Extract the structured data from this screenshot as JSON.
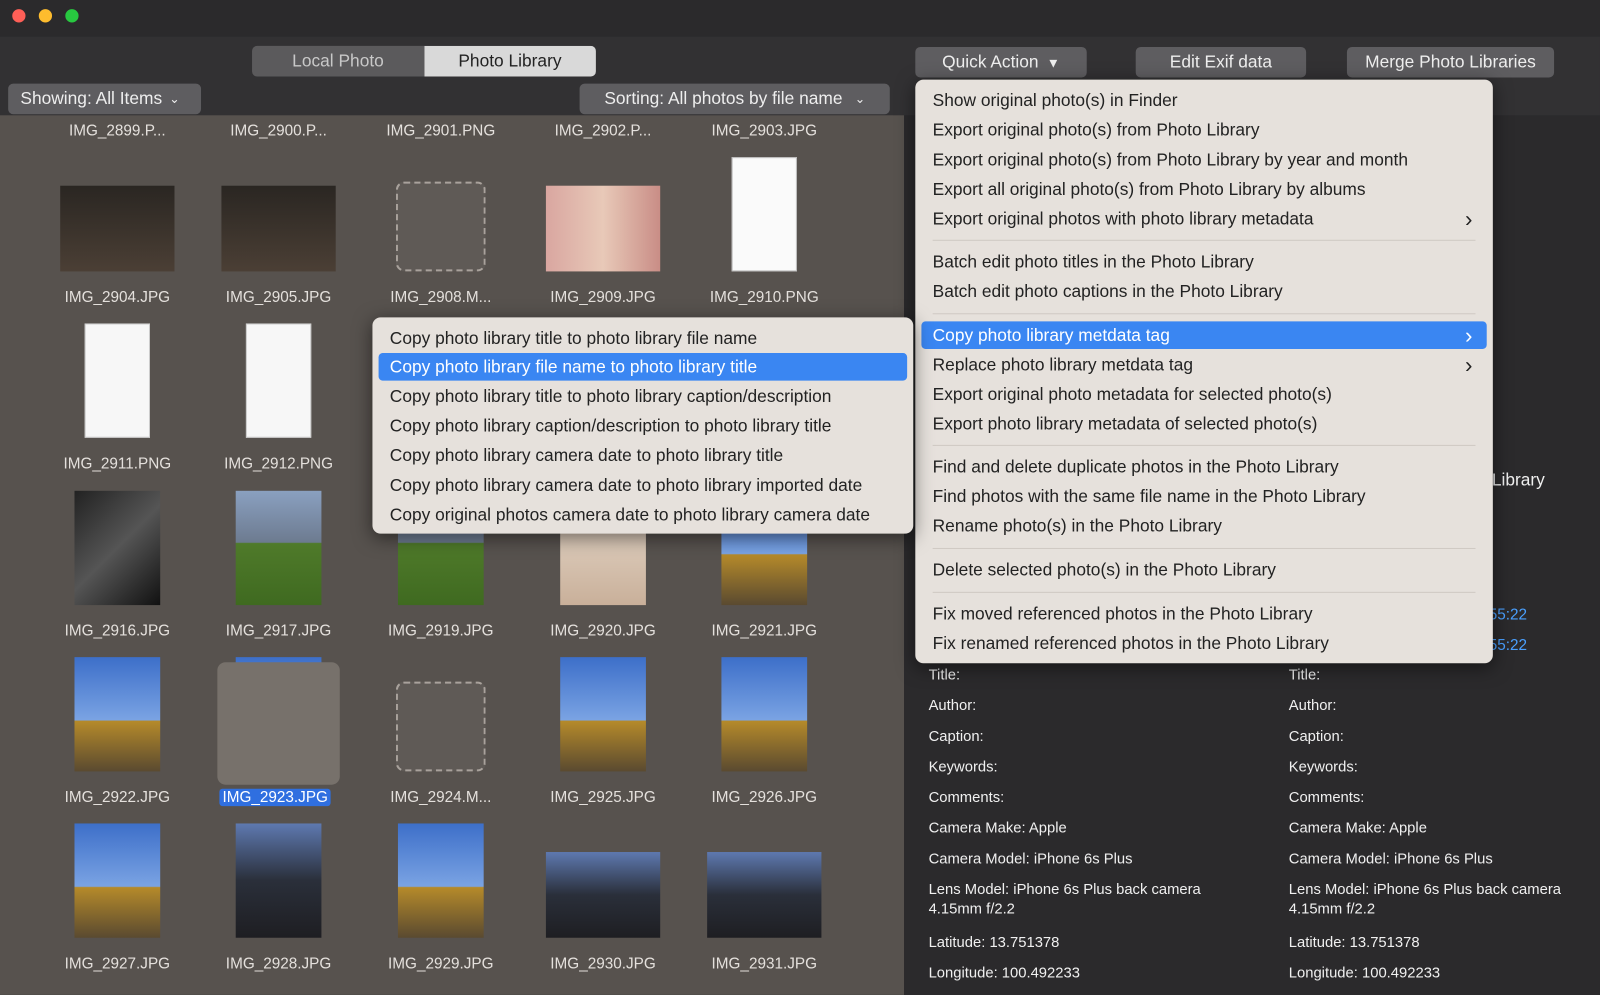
{
  "window": {
    "controls": [
      "close",
      "minimize",
      "zoom"
    ],
    "colors": {
      "close": "#fe5f57",
      "minimize": "#febc2e",
      "zoom": "#28c840",
      "accent": "#3a86f2"
    }
  },
  "tabs": [
    {
      "label": "Local Photo",
      "active": false
    },
    {
      "label": "Photo Library",
      "active": true
    }
  ],
  "toolbar": {
    "quick_action": "Quick Action",
    "edit_exif": "Edit Exif data",
    "merge": "Merge Photo Libraries"
  },
  "filters": {
    "showing": "Showing: All Items",
    "sorting": "Sorting: All photos by file name"
  },
  "photos": [
    [
      "IMG_2899.P...",
      "IMG_2900.P...",
      "IMG_2901.PNG",
      "IMG_2902.P...",
      "IMG_2903.JPG"
    ],
    [
      "IMG_2904.JPG",
      "IMG_2905.JPG",
      "IMG_2908.M...",
      "IMG_2909.JPG",
      "IMG_2910.PNG"
    ],
    [
      "IMG_2911.PNG",
      "IMG_2912.PNG",
      "",
      "",
      ""
    ],
    [
      "IMG_2916.JPG",
      "IMG_2917.JPG",
      "IMG_2919.JPG",
      "IMG_2920.JPG",
      "IMG_2921.JPG"
    ],
    [
      "IMG_2922.JPG",
      "IMG_2923.JPG",
      "IMG_2924.M...",
      "IMG_2925.JPG",
      "IMG_2926.JPG"
    ],
    [
      "IMG_2927.JPG",
      "IMG_2928.JPG",
      "IMG_2929.JPG",
      "IMG_2930.JPG",
      "IMG_2931.JPG"
    ]
  ],
  "selected_photo": "IMG_2923.JPG",
  "quick_menu": [
    {
      "label": "Show original photo(s) in Finder"
    },
    {
      "label": "Export original photo(s) from Photo Library"
    },
    {
      "label": "Export original photo(s) from Photo Library by year and month"
    },
    {
      "label": "Export all original photo(s) from Photo Library by albums"
    },
    {
      "label": "Export original photos with photo library metadata",
      "submenu": true
    },
    {
      "label": "Batch edit photo titles in the Photo Library"
    },
    {
      "label": "Batch edit photo captions in the Photo Library"
    },
    {
      "label": "Copy photo library metdata tag",
      "submenu": true,
      "highlighted": true
    },
    {
      "label": "Replace photo library metdata tag",
      "submenu": true
    },
    {
      "label": "Export original photo metadata for selected photo(s)"
    },
    {
      "label": "Export photo library metadata of selected photo(s)"
    },
    {
      "label": "Find and delete duplicate photos in the Photo Library"
    },
    {
      "label": "Find photos with the same file name in the Photo Library"
    },
    {
      "label": "Rename photo(s) in the Photo Library"
    },
    {
      "label": "Delete selected photo(s) in the Photo Library"
    },
    {
      "label": "Fix moved referenced photos in the Photo Library"
    },
    {
      "label": "Fix renamed referenced photos in the Photo Library"
    }
  ],
  "sub_menu": [
    {
      "label": "Copy photo library title to photo library file name"
    },
    {
      "label": "Copy photo library file name to photo library title",
      "highlighted": true
    },
    {
      "label": "Copy photo library title to photo library caption/description"
    },
    {
      "label": "Copy photo library caption/description to photo library title"
    },
    {
      "label": "Copy photo library camera date to photo library title"
    },
    {
      "label": "Copy photo library camera date to photo library imported date"
    },
    {
      "label": "Copy original photos camera date to photo library camera date"
    }
  ],
  "right": {
    "partial_label": "Library",
    "date_fragment_1": "55:22",
    "date_fragment_2": "55:22",
    "left_meta": [
      "Title:",
      "Author:",
      "Caption:",
      "Keywords:",
      "Comments:",
      "Camera Make: Apple",
      "Camera Model: iPhone 6s Plus",
      "Lens Model: iPhone 6s Plus back camera 4.15mm f/2.2",
      "Latitude: 13.751378",
      "Longitude: 100.492233"
    ],
    "right_meta": [
      "Title:",
      "Author:",
      "Caption:",
      "Keywords:",
      "Comments:",
      "Camera Make: Apple",
      "Camera Model: iPhone 6s Plus",
      "Lens Model: iPhone 6s Plus back camera 4.15mm f/2.2",
      "Latitude: 13.751378",
      "Longitude: 100.492233"
    ]
  }
}
